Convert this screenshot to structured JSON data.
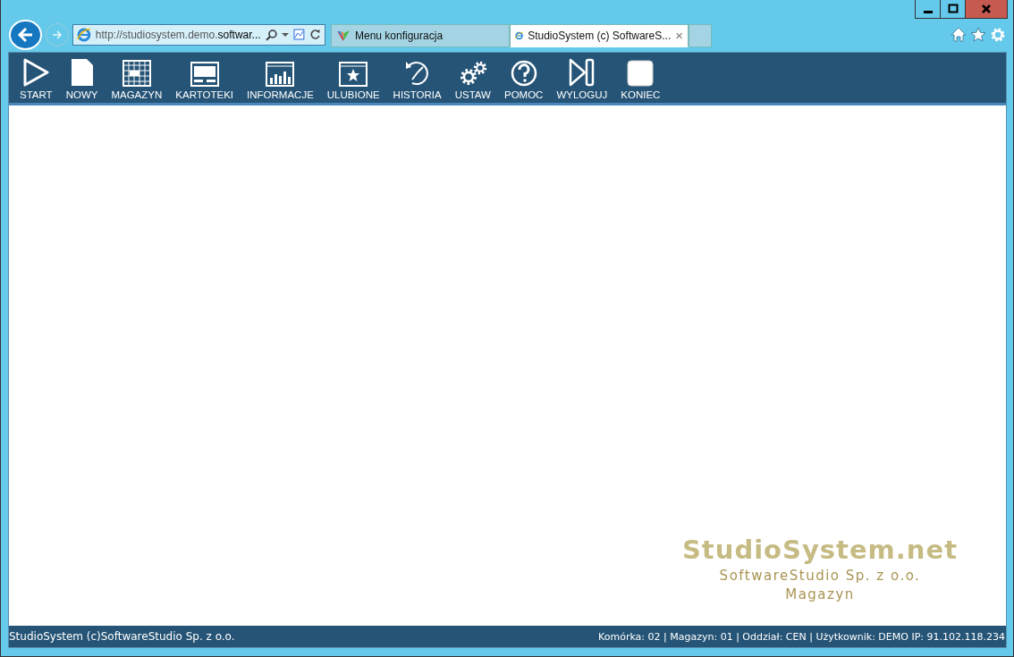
{
  "browser": {
    "address": {
      "prefix": "http://studiosystem.demo.",
      "host": "softwar..."
    },
    "tabs": [
      {
        "label": "Menu konfiguracja",
        "kind": "colorful",
        "selected": false
      },
      {
        "label": "StudioSystem (c) SoftwareS...",
        "kind": "ie",
        "selected": true
      }
    ],
    "tab_close": "×"
  },
  "toolbar": [
    {
      "label": "START",
      "kind": "play"
    },
    {
      "label": "NOWY",
      "kind": "page"
    },
    {
      "label": "MAGAZYN",
      "kind": "grid"
    },
    {
      "label": "KARTOTEKI",
      "kind": "window"
    },
    {
      "label": "INFORMACJE",
      "kind": "chart"
    },
    {
      "label": "ULUBIONE",
      "kind": "star"
    },
    {
      "label": "HISTORIA",
      "kind": "history"
    },
    {
      "label": "USTAW",
      "kind": "gears"
    },
    {
      "label": "POMOC",
      "kind": "help"
    },
    {
      "label": "WYLOGUJ",
      "kind": "logout"
    },
    {
      "label": "KONIEC",
      "kind": "stop"
    }
  ],
  "watermark": {
    "title": "StudioSystem.net",
    "company": "SoftwareStudio Sp. z o.o.",
    "module": "Magazyn"
  },
  "status_bar": {
    "left": "StudioSystem (c)SoftwareStudio Sp. z o.o.",
    "right": "Komórka: 02 | Magazyn: 01 | Oddział: CEN | Użytkownik: DEMO IP: 91.102.118.234"
  }
}
